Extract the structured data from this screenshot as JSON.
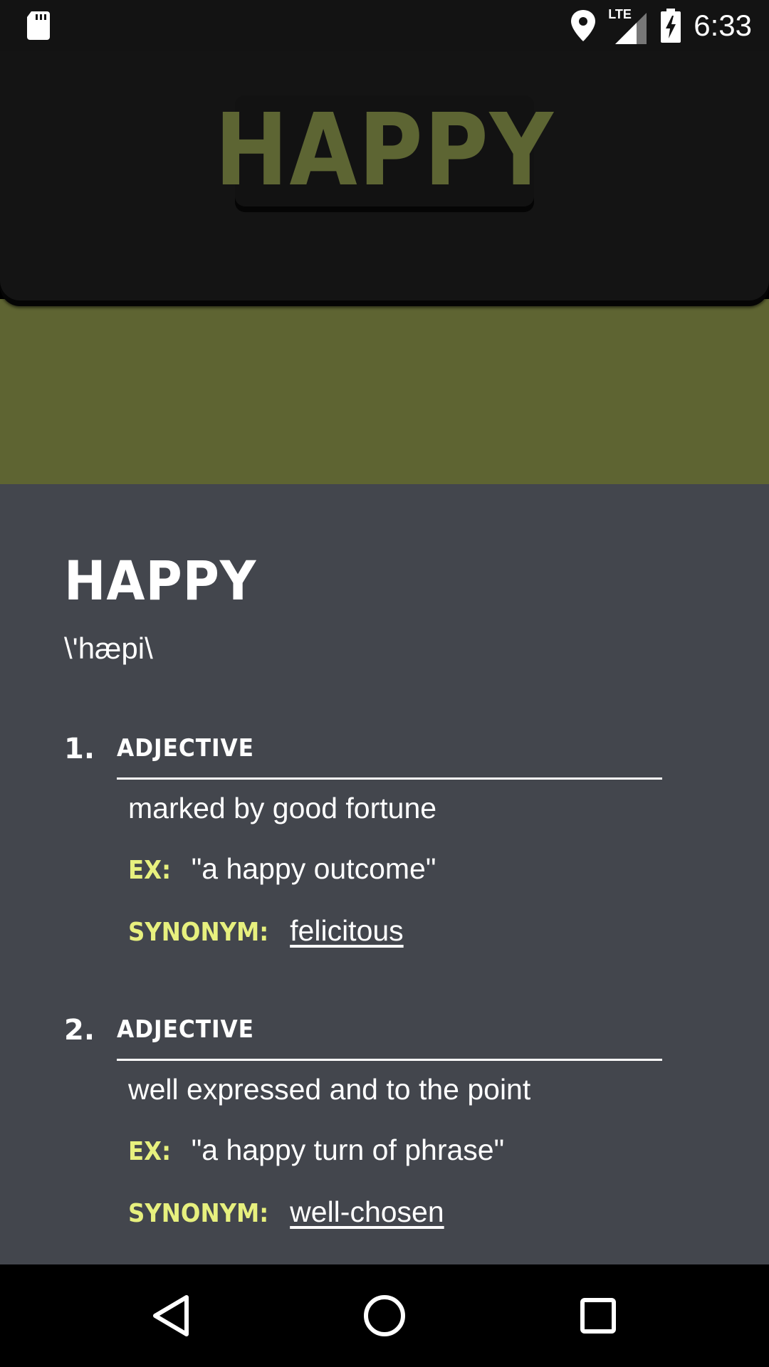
{
  "status_bar": {
    "network": "LTE",
    "time": "6:33"
  },
  "header": {
    "logo_text": "HAPPY",
    "accent_color": "#5d6533"
  },
  "entry": {
    "word": "HAPPY",
    "pronunciation": "\\'hæpi\\",
    "senses": [
      {
        "number": "1.",
        "pos": "ADJECTIVE",
        "definition": "marked by good fortune",
        "ex_label": "EX:",
        "example": "\"a happy outcome\"",
        "synonym_label": "SYNONYM:",
        "synonym": "felicitous"
      },
      {
        "number": "2.",
        "pos": "ADJECTIVE",
        "definition": "well expressed and to the point",
        "ex_label": "EX:",
        "example": "\"a happy turn of phrase\"",
        "synonym_label": "SYNONYM:",
        "synonym": "well-chosen"
      }
    ]
  },
  "colors": {
    "olive_band": "#5e6432",
    "content_bg": "#43464d",
    "tag_yellow": "#e7f07e"
  },
  "nav": {
    "back_icon": "back-triangle-icon",
    "home_icon": "home-circle-icon",
    "recents_icon": "recents-square-icon"
  }
}
